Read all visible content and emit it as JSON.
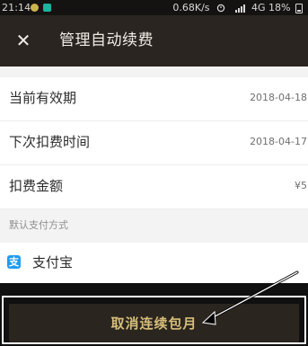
{
  "status_bar": {
    "time": "21:14",
    "speed": "0.68K/s",
    "network": "4G",
    "battery": "18%"
  },
  "header": {
    "title": "管理自动续费"
  },
  "details": [
    {
      "label": "当前有效期",
      "value": "2018-04-18"
    },
    {
      "label": "下次扣费时间",
      "value": "2018-04-17"
    },
    {
      "label": "扣费金额",
      "value": "¥5"
    }
  ],
  "payment": {
    "section_label": "默认支付方式",
    "method": "支付宝",
    "icon_text": "支"
  },
  "action": {
    "cancel_label": "取消连续包月"
  }
}
